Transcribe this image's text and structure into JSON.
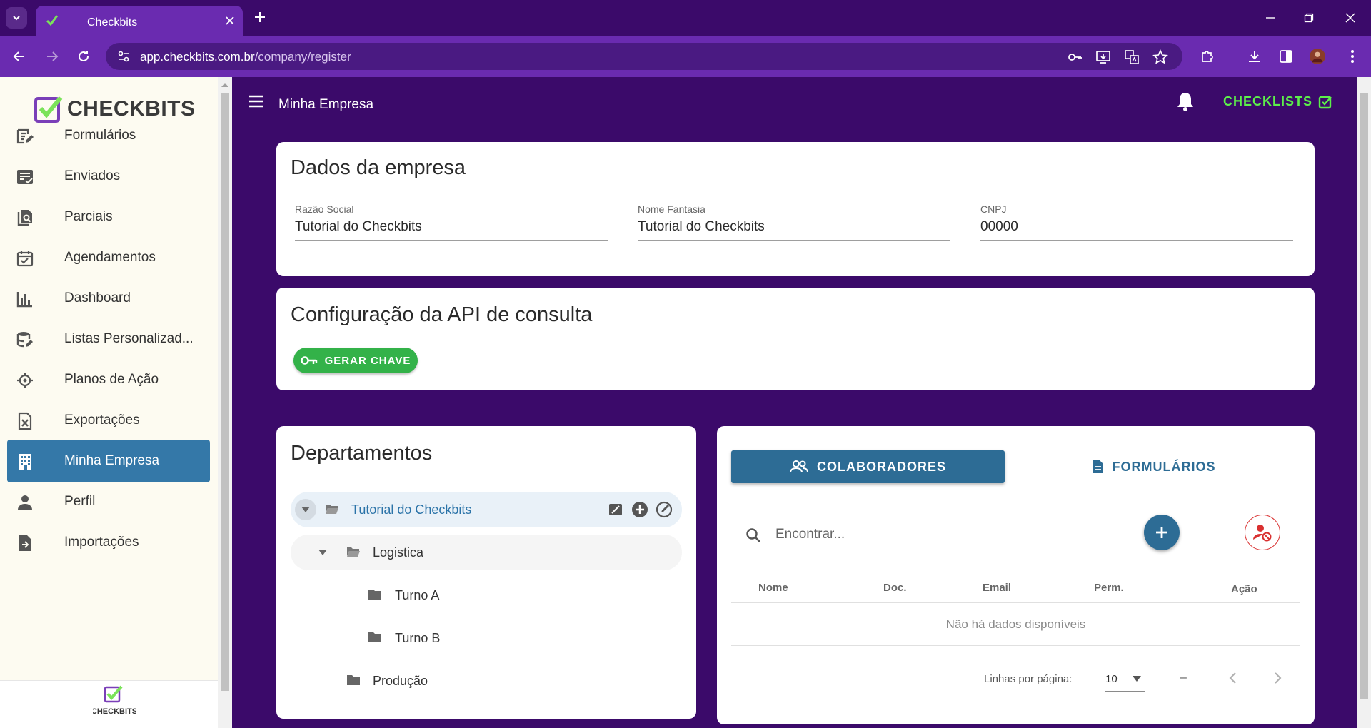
{
  "browser": {
    "tab_title": "Checkbits",
    "url_host": "app.checkbits.com.br",
    "url_path": "/company/register"
  },
  "sidebar": {
    "brand": "CHECKBITS",
    "footer_brand": "CHECKBITS",
    "items": [
      {
        "label": "Formulários",
        "icon": "form-edit-icon"
      },
      {
        "label": "Enviados",
        "icon": "sent-list-icon"
      },
      {
        "label": "Parciais",
        "icon": "partial-docs-icon"
      },
      {
        "label": "Agendamentos",
        "icon": "calendar-check-icon"
      },
      {
        "label": "Dashboard",
        "icon": "bar-chart-icon"
      },
      {
        "label": "Listas Personalizad...",
        "icon": "database-edit-icon"
      },
      {
        "label": "Planos de Ação",
        "icon": "crosshair-icon"
      },
      {
        "label": "Exportações",
        "icon": "excel-export-icon"
      },
      {
        "label": "Minha Empresa",
        "icon": "building-icon",
        "active": true
      },
      {
        "label": "Perfil",
        "icon": "person-icon"
      },
      {
        "label": "Importações",
        "icon": "file-import-icon"
      }
    ]
  },
  "appbar": {
    "title": "Minha Empresa",
    "checklists_label": "CHECKLISTS"
  },
  "company": {
    "title": "Dados da empresa",
    "razao_social_label": "Razão Social",
    "razao_social_value": "Tutorial do Checkbits",
    "nome_fantasia_label": "Nome Fantasia",
    "nome_fantasia_value": "Tutorial do Checkbits",
    "cnpj_label": "CNPJ",
    "cnpj_value": "00000"
  },
  "api": {
    "title": "Configuração da API de consulta",
    "button_label": "GERAR CHAVE"
  },
  "departments": {
    "title": "Departamentos",
    "root": "Tutorial do Checkbits",
    "logistica": "Logistica",
    "turno_a": "Turno A",
    "turno_b": "Turno B",
    "producao": "Produção"
  },
  "people": {
    "tab_colaboradores": "COLABORADORES",
    "tab_formularios": "FORMULÁRIOS",
    "search_placeholder": "Encontrar...",
    "columns": [
      "Nome",
      "Doc.",
      "Email",
      "Perm.",
      "Ação"
    ],
    "empty_text": "Não há dados disponíveis",
    "rows_per_page_label": "Linhas por página:",
    "rows_per_page_value": "10",
    "range_text": "–"
  },
  "colors": {
    "primary_purple": "#3b0a6a",
    "chrome_purple": "#6a2bb0",
    "accent_blue": "#2d6c95",
    "active_nav": "#3478a8",
    "success_green": "#33b249",
    "checklists_green": "#5cf04a",
    "danger_red": "#d93030"
  }
}
